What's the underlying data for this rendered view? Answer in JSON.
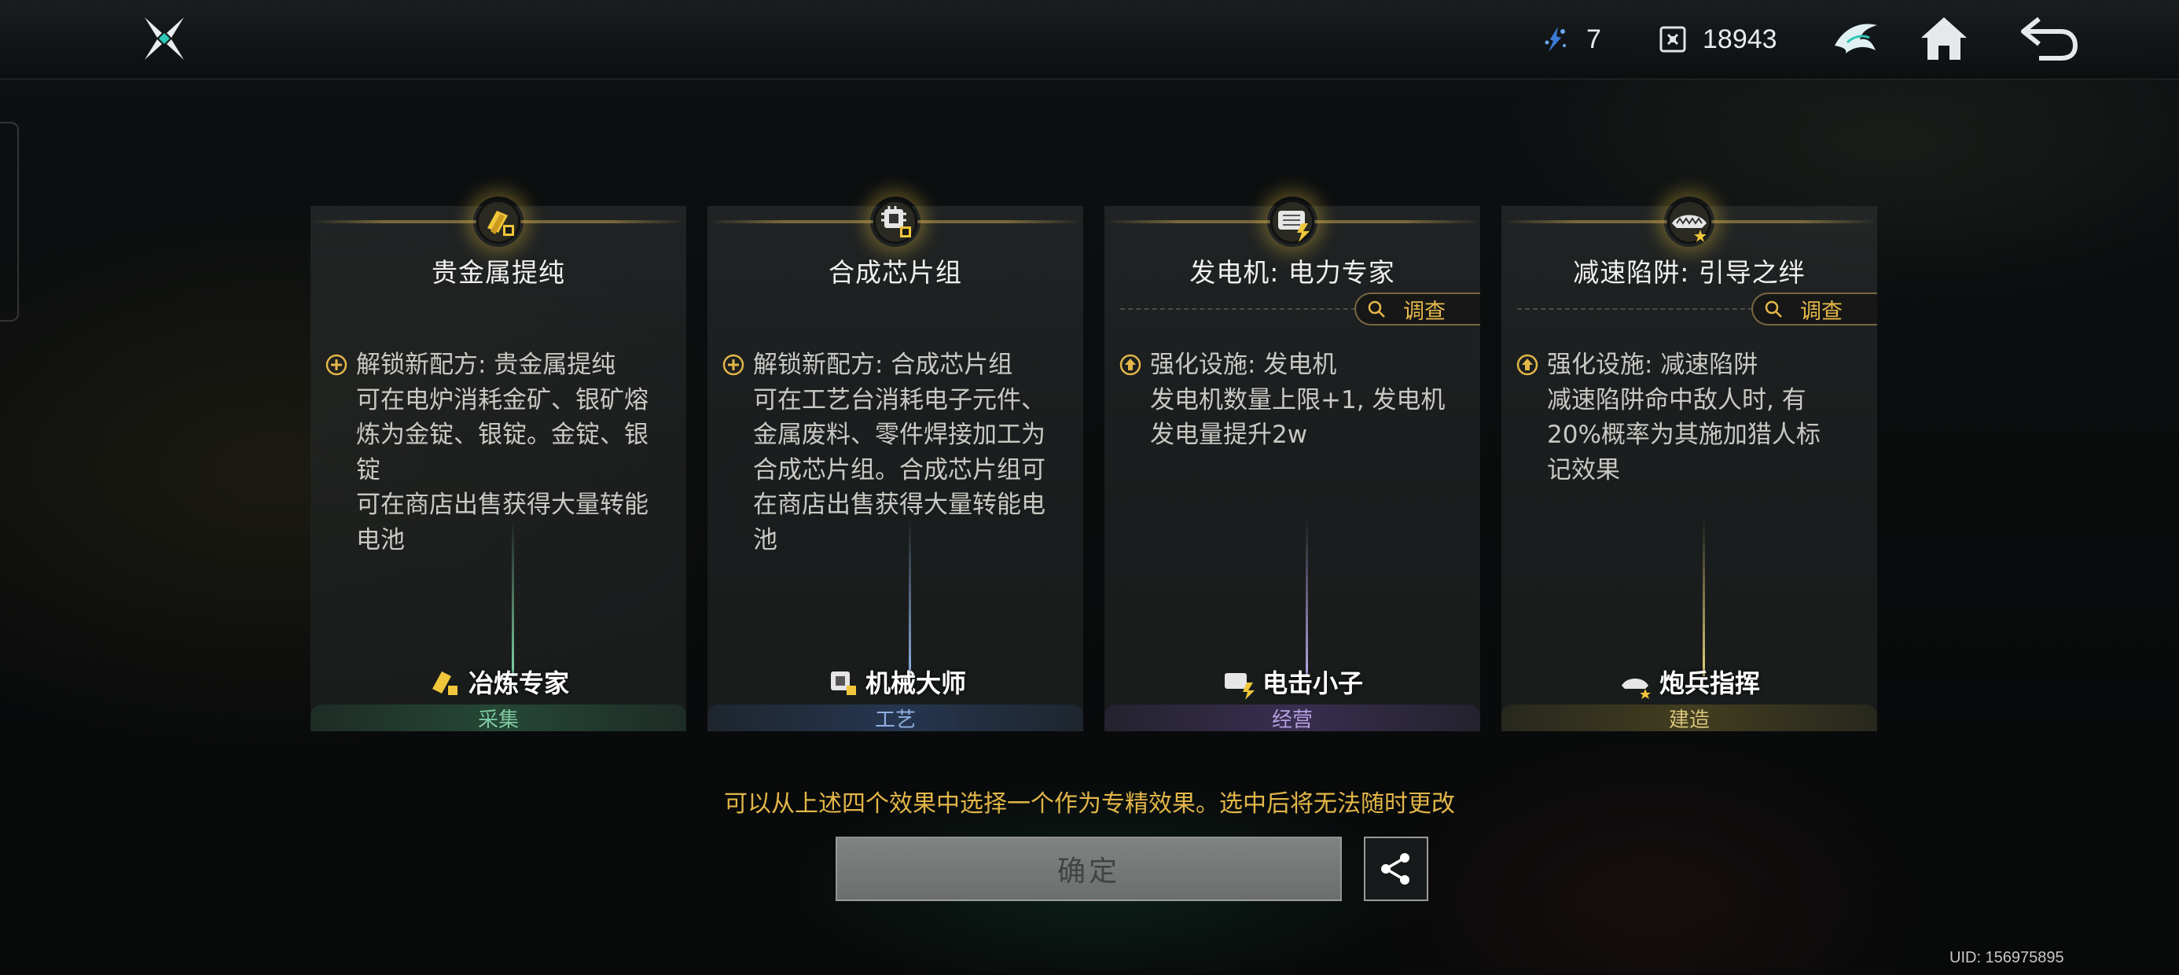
{
  "topbar": {
    "resources": [
      {
        "icon": "energy-shard-icon",
        "value": "7"
      },
      {
        "icon": "chip-currency-icon",
        "value": "18943"
      }
    ]
  },
  "cards": [
    {
      "title": "贵金属提纯",
      "medal_icon": "gold-bar-gear-icon",
      "effect_icon": "plus-circle-icon",
      "effect_head": "解锁新配方: 贵金属提纯",
      "effect_lines": [
        "可在电炉消耗金矿、银矿熔",
        "炼为金锭、银锭。金锭、银锭",
        "可在商店出售获得大量转能",
        "电池"
      ],
      "role": "冶炼专家",
      "category": "采集",
      "accent": "#2f6b4c",
      "beam": "#7fd3a6"
    },
    {
      "title": "合成芯片组",
      "medal_icon": "chip-gear-icon",
      "effect_icon": "plus-circle-icon",
      "effect_head": "解锁新配方: 合成芯片组",
      "effect_lines": [
        "可在工艺台消耗电子元件、",
        "金属废料、零件焊接加工为",
        "合成芯片组。合成芯片组可",
        "在商店出售获得大量转能电",
        "池"
      ],
      "role": "机械大师",
      "category": "工艺",
      "accent": "#2f4873",
      "beam": "#8fb4e8"
    },
    {
      "title": "发电机: 电力专家",
      "medal_icon": "generator-bolt-icon",
      "investigate": "调查",
      "effect_icon": "upgrade-circle-icon",
      "effect_head": "强化设施: 发电机",
      "effect_lines": [
        "发电机数量上限+1, 发电机",
        "发电量提升2w"
      ],
      "role": "电击小子",
      "category": "经营",
      "accent": "#4d3a72",
      "beam": "#b9a6e8"
    },
    {
      "title": "减速陷阱: 引导之绊",
      "medal_icon": "trap-star-icon",
      "investigate": "调查",
      "effect_icon": "upgrade-circle-icon",
      "effect_head": "强化设施: 减速陷阱",
      "effect_lines": [
        "减速陷阱命中敌人时, 有",
        "20%概率为其施加猎人标",
        "记效果"
      ],
      "role": "炮兵指挥",
      "category": "建造",
      "accent": "#5e5422",
      "beam": "#e6d27a"
    }
  ],
  "hint": "可以从上述四个效果中选择一个作为专精效果。选中后将无法随时更改",
  "confirm_label": "确定",
  "uid": "UID: 156975895",
  "colors": {
    "gold": "#e2b648",
    "background": "#0a0c0d"
  }
}
